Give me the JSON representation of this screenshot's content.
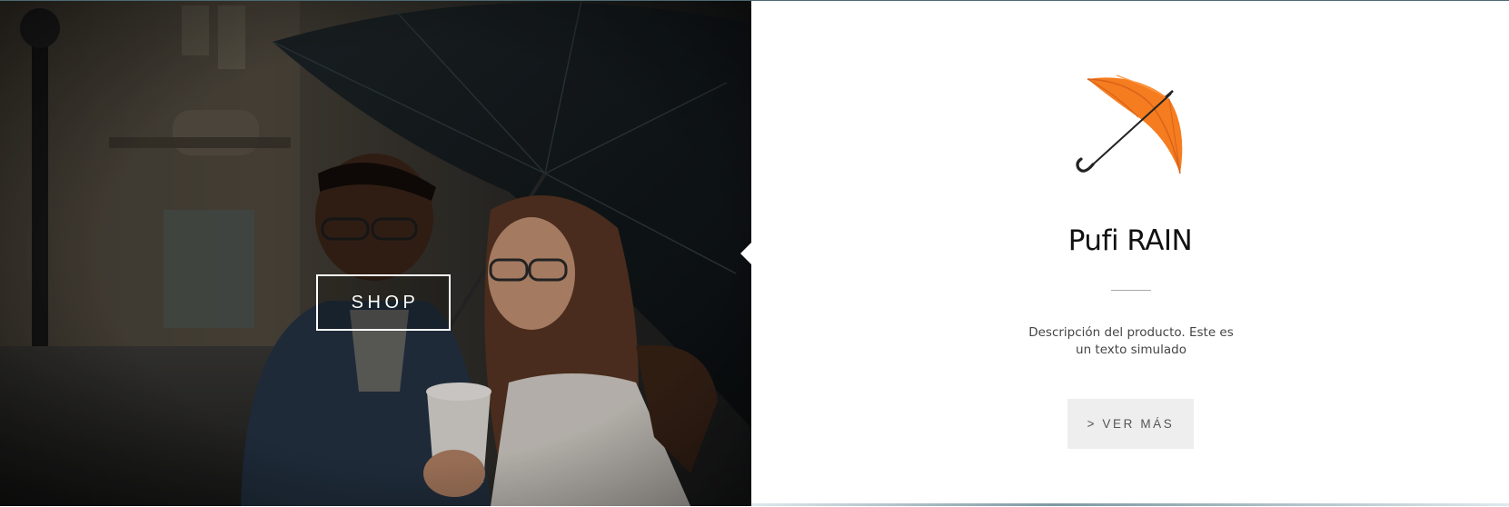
{
  "hero": {
    "image_icon": "umbrella-couple-photo",
    "shop_label": "SHOP"
  },
  "product": {
    "icon": "orange-umbrella-icon",
    "icon_color": "#f57c1f",
    "title": "Pufi RAIN",
    "description": "Descripción del producto. Este es un texto simulado",
    "more_label": "> VER MÁS"
  },
  "colors": {
    "button_bg": "#eeeeee",
    "button_text": "#555555",
    "title_text": "#111111"
  }
}
